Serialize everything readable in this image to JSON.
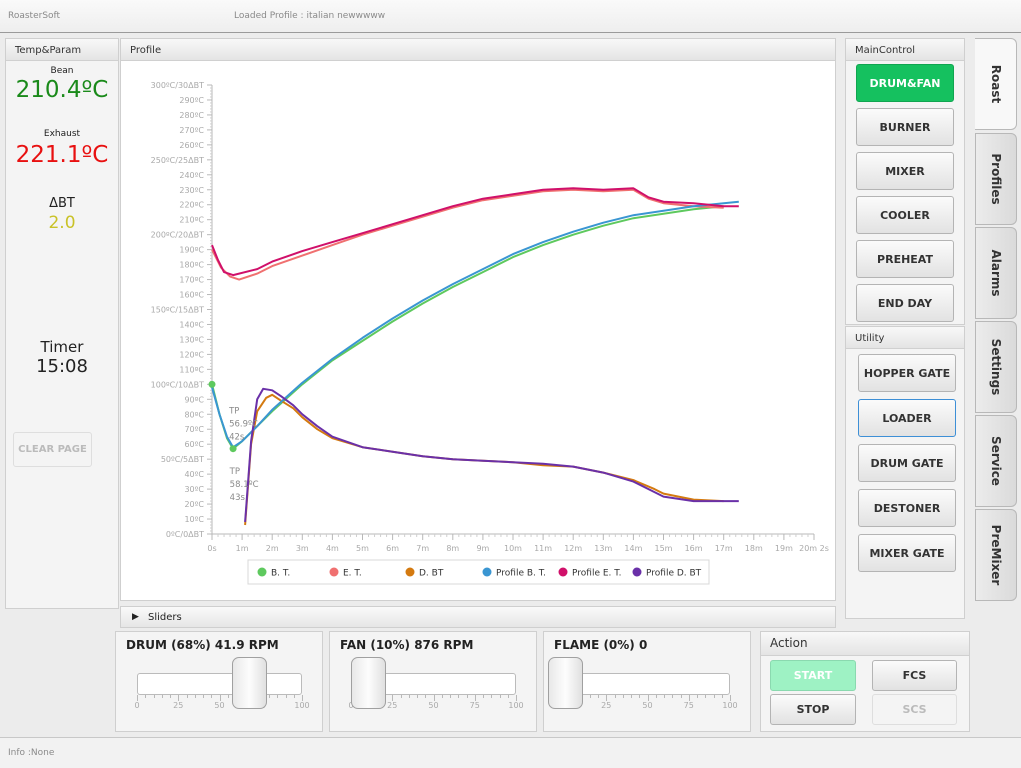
{
  "app": {
    "title": "RoasterSoft",
    "profile_text": "Loaded Profile : italian newwwww"
  },
  "status": {
    "info": "Info :None"
  },
  "left": {
    "header": "Temp&Param",
    "bean_label": "Bean",
    "bean_value": "210.4ºC",
    "exhaust_label": "Exhaust",
    "exhaust_value": "221.1ºC",
    "dbt_label": "ΔBT",
    "dbt_value": "2.0",
    "timer_label": "Timer",
    "timer_value": "15:08",
    "clear_label": "CLEAR PAGE"
  },
  "profile": {
    "header": "Profile"
  },
  "sliders_header": "Sliders",
  "main_control": {
    "header": "MainControl",
    "buttons": [
      "DRUM&FAN",
      "BURNER",
      "MIXER",
      "COOLER",
      "PREHEAT",
      "END DAY"
    ]
  },
  "utility": {
    "header": "Utility",
    "buttons": [
      "HOPPER GATE",
      "LOADER",
      "DRUM GATE",
      "DESTONER",
      "MIXER GATE"
    ]
  },
  "tabs": [
    "Roast",
    "Profiles",
    "Alarms",
    "Settings",
    "Service",
    "PreMixer"
  ],
  "drum": {
    "title": "DRUM (68%) 41.9 RPM",
    "level": 68
  },
  "fan": {
    "title": "FAN (10%) 876 RPM",
    "level": 10
  },
  "flame": {
    "title": "FLAME (0%) 0",
    "level": 0
  },
  "slider_scale": [
    "0",
    "25",
    "50",
    "75",
    "100"
  ],
  "action": {
    "header": "Action",
    "start": "START",
    "fcs": "FCS",
    "stop": "STOP",
    "scs": "SCS"
  },
  "colors": {
    "bt": "#5ec95e",
    "et": "#f07070",
    "dbt": "#d47a10",
    "pbt": "#3a96d2",
    "pet": "#d0106a",
    "pdbt": "#6a30a8",
    "drum_fan_active": "#15c15f"
  },
  "chart_data": {
    "type": "line",
    "x_ticks": [
      "0s",
      "1m",
      "2m",
      "3m",
      "4m",
      "5m",
      "6m",
      "7m",
      "8m",
      "9m",
      "10m",
      "11m",
      "12m",
      "13m",
      "14m",
      "15m",
      "16m",
      "17m",
      "18m",
      "19m",
      "20m 2s"
    ],
    "y_ticks": [
      "0ºC/0ΔBT",
      "10ºC",
      "20ºC",
      "30ºC",
      "40ºC",
      "50ºC/5ΔBT",
      "60ºC",
      "70ºC",
      "80ºC",
      "90ºC",
      "100ºC/10ΔBT",
      "110ºC",
      "120ºC",
      "130ºC",
      "140ºC",
      "150ºC/15ΔBT",
      "160ºC",
      "170ºC",
      "180ºC",
      "190ºC",
      "200ºC/20ΔBT",
      "210ºC",
      "220ºC",
      "230ºC",
      "240ºC",
      "250ºC/25ΔBT",
      "260ºC",
      "270ºC",
      "280ºC",
      "290ºC",
      "300ºC/30ΔBT"
    ],
    "xlim": [
      0,
      20
    ],
    "ylim": [
      0,
      300
    ],
    "annotations": [
      {
        "text": [
          "TP",
          "56.9ºC",
          "42s"
        ],
        "x": 0.7,
        "y": 57
      },
      {
        "text": [
          "TP",
          "58.1ºC",
          "43s"
        ],
        "x": 0.72,
        "y": 58
      }
    ],
    "series": [
      {
        "name": "B. T.",
        "color": "#5ec95e",
        "points": [
          [
            0,
            100
          ],
          [
            0.25,
            80
          ],
          [
            0.5,
            64
          ],
          [
            0.7,
            57
          ],
          [
            1,
            62
          ],
          [
            1.5,
            72
          ],
          [
            2,
            82
          ],
          [
            3,
            100
          ],
          [
            4,
            116
          ],
          [
            5,
            129
          ],
          [
            6,
            142
          ],
          [
            7,
            154
          ],
          [
            8,
            165
          ],
          [
            9,
            175
          ],
          [
            10,
            185
          ],
          [
            11,
            193
          ],
          [
            12,
            200
          ],
          [
            13,
            206
          ],
          [
            14,
            211
          ],
          [
            15,
            214
          ],
          [
            16,
            217
          ],
          [
            17,
            219
          ]
        ]
      },
      {
        "name": "E. T.",
        "color": "#f07070",
        "points": [
          [
            0,
            190
          ],
          [
            0.3,
            178
          ],
          [
            0.6,
            172
          ],
          [
            0.9,
            170
          ],
          [
            1.5,
            174
          ],
          [
            2,
            179
          ],
          [
            3,
            186
          ],
          [
            4,
            193
          ],
          [
            5,
            200
          ],
          [
            6,
            206
          ],
          [
            7,
            212
          ],
          [
            8,
            218
          ],
          [
            9,
            223
          ],
          [
            10,
            226
          ],
          [
            11,
            229
          ],
          [
            12,
            230
          ],
          [
            13,
            229
          ],
          [
            14,
            230
          ],
          [
            14.5,
            224
          ],
          [
            15,
            221
          ],
          [
            16,
            219
          ],
          [
            17,
            218
          ]
        ]
      },
      {
        "name": "D. BT",
        "color": "#d47a10",
        "points": [
          [
            1.1,
            6
          ],
          [
            1.3,
            60
          ],
          [
            1.5,
            82
          ],
          [
            1.8,
            91
          ],
          [
            2,
            93
          ],
          [
            2.3,
            89
          ],
          [
            2.7,
            84
          ],
          [
            3,
            78
          ],
          [
            3.5,
            70
          ],
          [
            4,
            64
          ],
          [
            5,
            58
          ],
          [
            6,
            55
          ],
          [
            7,
            52
          ],
          [
            8,
            50
          ],
          [
            9,
            49
          ],
          [
            10,
            48
          ],
          [
            11,
            46
          ],
          [
            12,
            45
          ],
          [
            13,
            41
          ],
          [
            14,
            36
          ],
          [
            14.7,
            30
          ],
          [
            15,
            27
          ],
          [
            16,
            23
          ],
          [
            17,
            22
          ]
        ]
      },
      {
        "name": "Profile B. T.",
        "color": "#3a96d2",
        "points": [
          [
            0,
            98
          ],
          [
            0.25,
            80
          ],
          [
            0.5,
            65
          ],
          [
            0.7,
            58
          ],
          [
            1,
            62
          ],
          [
            1.5,
            72
          ],
          [
            2,
            83
          ],
          [
            3,
            101
          ],
          [
            4,
            117
          ],
          [
            5,
            131
          ],
          [
            6,
            144
          ],
          [
            7,
            156
          ],
          [
            8,
            167
          ],
          [
            9,
            177
          ],
          [
            10,
            187
          ],
          [
            11,
            195
          ],
          [
            12,
            202
          ],
          [
            13,
            208
          ],
          [
            14,
            213
          ],
          [
            15,
            216
          ],
          [
            16,
            219
          ],
          [
            17,
            221
          ],
          [
            17.5,
            222
          ]
        ]
      },
      {
        "name": "Profile E. T.",
        "color": "#d0106a",
        "points": [
          [
            0,
            193
          ],
          [
            0.2,
            183
          ],
          [
            0.4,
            175
          ],
          [
            0.7,
            173
          ],
          [
            1.5,
            177
          ],
          [
            2,
            182
          ],
          [
            3,
            189
          ],
          [
            4,
            195
          ],
          [
            5,
            201
          ],
          [
            6,
            207
          ],
          [
            7,
            213
          ],
          [
            8,
            219
          ],
          [
            9,
            224
          ],
          [
            10,
            227
          ],
          [
            11,
            230
          ],
          [
            12,
            231
          ],
          [
            13,
            230
          ],
          [
            14,
            231
          ],
          [
            14.5,
            225
          ],
          [
            15,
            222
          ],
          [
            16,
            221
          ],
          [
            17,
            219
          ],
          [
            17.5,
            219
          ]
        ]
      },
      {
        "name": "Profile D. BT",
        "color": "#6a30a8",
        "points": [
          [
            1.1,
            8
          ],
          [
            1.3,
            62
          ],
          [
            1.5,
            90
          ],
          [
            1.7,
            97
          ],
          [
            2,
            96
          ],
          [
            2.3,
            92
          ],
          [
            2.7,
            86
          ],
          [
            3,
            80
          ],
          [
            3.5,
            72
          ],
          [
            4,
            65
          ],
          [
            5,
            58
          ],
          [
            6,
            55
          ],
          [
            7,
            52
          ],
          [
            8,
            50
          ],
          [
            9,
            49
          ],
          [
            10,
            48
          ],
          [
            11,
            47
          ],
          [
            12,
            45
          ],
          [
            13,
            41
          ],
          [
            14,
            35
          ],
          [
            14.7,
            28
          ],
          [
            15,
            25
          ],
          [
            16,
            22
          ],
          [
            17,
            22
          ],
          [
            17.5,
            22
          ]
        ]
      }
    ]
  }
}
